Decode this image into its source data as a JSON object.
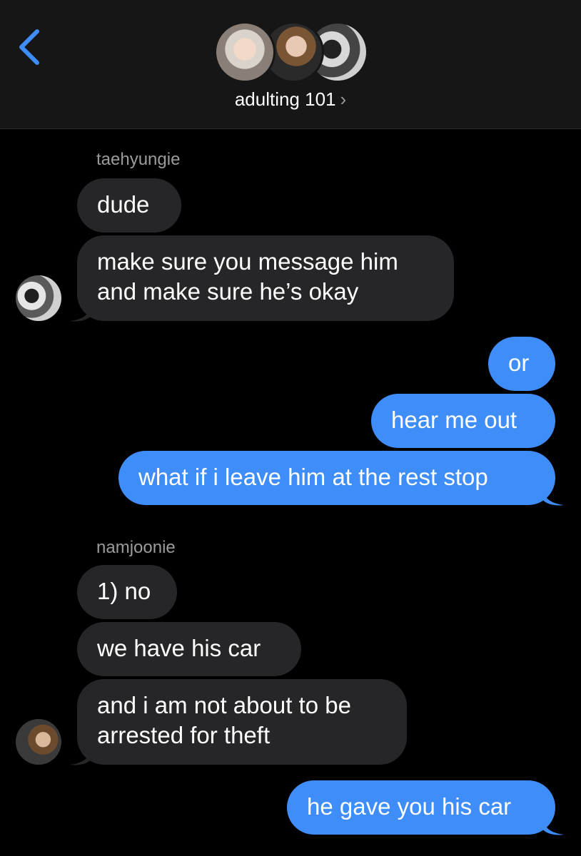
{
  "header": {
    "back_icon": "chevron-left-icon",
    "chat_name": "adulting 101",
    "chevron": "›",
    "accent": "#3e8df8"
  },
  "messages": [
    {
      "group_sender": "taehyungie"
    },
    {
      "text": "dude"
    },
    {
      "text": "make sure you message him"
    },
    {
      "text": "and make sure he’s okay"
    },
    {
      "text": "or"
    },
    {
      "text": "hear me out"
    },
    {
      "text": "what if i leave him at the rest stop"
    },
    {
      "group_sender": "namjoonie"
    },
    {
      "text": "1) no"
    },
    {
      "text": "we have his car"
    },
    {
      "text": "and i am not about to be"
    },
    {
      "text": "arrested for theft"
    },
    {
      "text": "he gave you his car"
    }
  ],
  "colors": {
    "incoming_bubble": "#262628",
    "outgoing_bubble": "#3e8df8",
    "background": "#000000",
    "sender_name": "#9b9b9b"
  }
}
